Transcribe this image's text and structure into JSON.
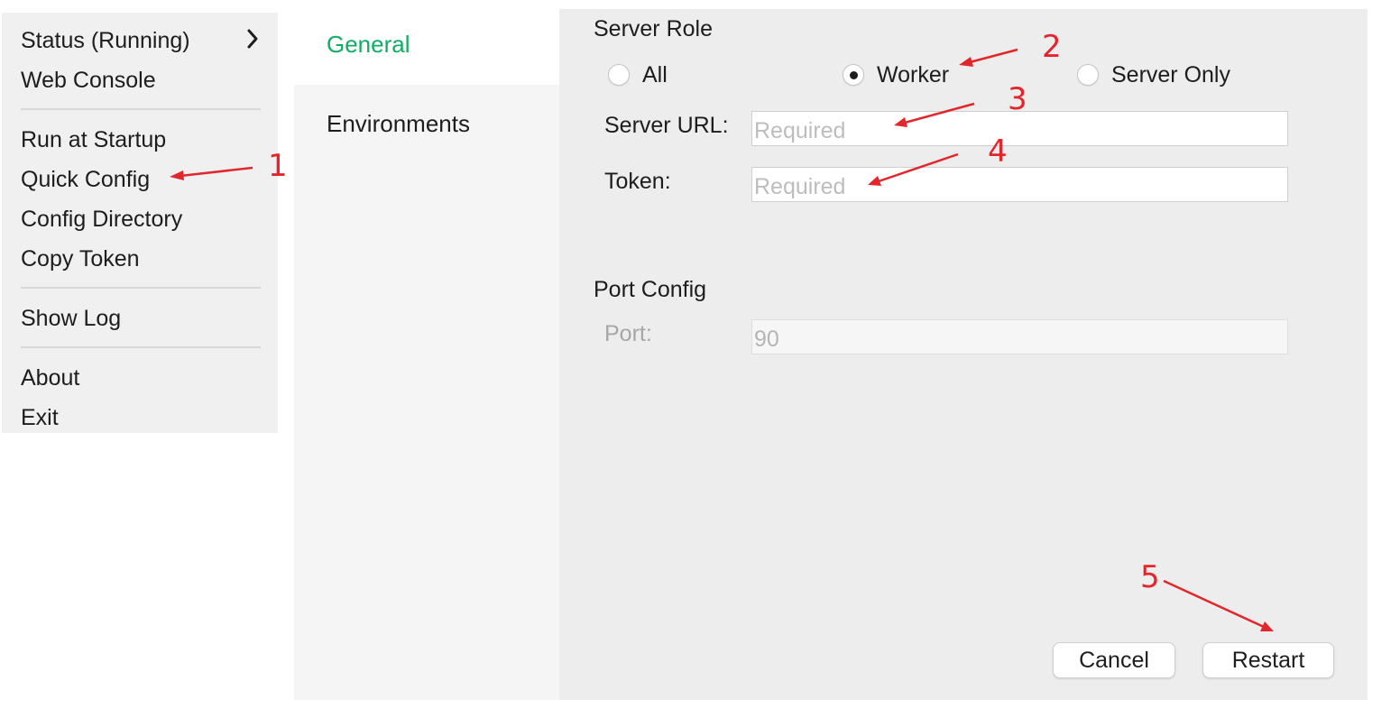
{
  "tray_menu": {
    "items": [
      {
        "label": "Status (Running)"
      },
      {
        "label": "Web Console"
      },
      {
        "label": "Run at Startup"
      },
      {
        "label": "Quick Config"
      },
      {
        "label": "Config Directory"
      },
      {
        "label": "Copy Token"
      },
      {
        "label": "Show Log"
      },
      {
        "label": "About"
      },
      {
        "label": "Exit"
      }
    ],
    "submenu_icon": "chevron-right-icon"
  },
  "settings": {
    "nav": {
      "tabs": [
        {
          "label": "General",
          "active": true
        },
        {
          "label": "Environments",
          "active": false
        }
      ],
      "active_color": "#0fae62"
    },
    "server_role": {
      "title": "Server Role",
      "options": [
        {
          "label": "All",
          "checked": false
        },
        {
          "label": "Worker",
          "checked": true
        },
        {
          "label": "Server Only",
          "checked": false
        }
      ]
    },
    "server_url": {
      "label": "Server URL:",
      "value": "",
      "placeholder": "Required"
    },
    "token": {
      "label": "Token:",
      "value": "",
      "placeholder": "Required"
    },
    "port_config": {
      "title": "Port Config",
      "port": {
        "label": "Port:",
        "value": "90",
        "disabled": true
      }
    },
    "buttons": {
      "cancel": "Cancel",
      "restart": "Restart"
    }
  },
  "annotations": {
    "color": "#e2262b",
    "markers": [
      "1",
      "2",
      "3",
      "4",
      "5"
    ]
  }
}
